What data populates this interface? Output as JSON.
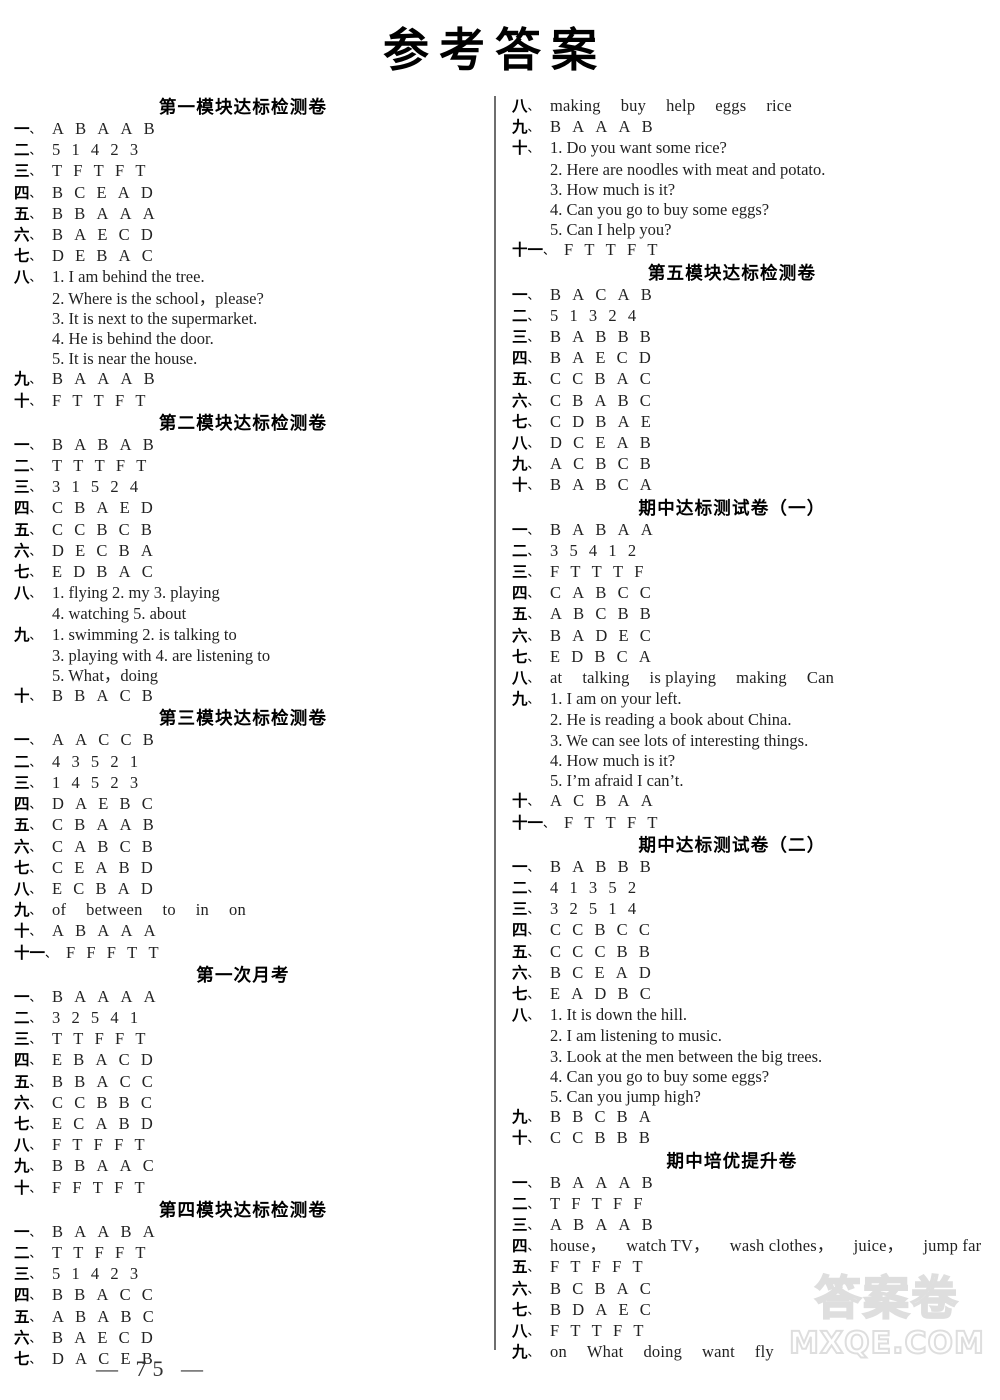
{
  "page": {
    "title": "参考答案",
    "page_number": "— 75 —",
    "watermark_cn": "答案卷",
    "watermark_url": "MXQE.COM"
  },
  "left_column": [
    {
      "heading": "第一模块达标检测卷",
      "rows": [
        {
          "num": "一",
          "type": "letters",
          "values": [
            "A",
            "B",
            "A",
            "A",
            "B"
          ]
        },
        {
          "num": "二",
          "type": "letters",
          "values": [
            "5",
            "1",
            "4",
            "2",
            "3"
          ]
        },
        {
          "num": "三",
          "type": "letters",
          "values": [
            "T",
            "F",
            "T",
            "F",
            "T"
          ]
        },
        {
          "num": "四",
          "type": "letters",
          "values": [
            "B",
            "C",
            "E",
            "A",
            "D"
          ]
        },
        {
          "num": "五",
          "type": "letters",
          "values": [
            "B",
            "B",
            "A",
            "A",
            "A"
          ]
        },
        {
          "num": "六",
          "type": "letters",
          "values": [
            "B",
            "A",
            "E",
            "C",
            "D"
          ]
        },
        {
          "num": "七",
          "type": "letters",
          "values": [
            "D",
            "E",
            "B",
            "A",
            "C"
          ]
        },
        {
          "num": "八",
          "type": "sentences",
          "sentences": [
            "1. I am behind the tree.",
            "2. Where is the school，please?",
            "3. It is next to the supermarket.",
            "4. He is behind the door.",
            "5. It is near the house."
          ]
        },
        {
          "num": "九",
          "type": "letters",
          "values": [
            "B",
            "A",
            "A",
            "A",
            "B"
          ]
        },
        {
          "num": "十",
          "type": "letters",
          "values": [
            "F",
            "T",
            "T",
            "F",
            "T"
          ]
        }
      ]
    },
    {
      "heading": "第二模块达标检测卷",
      "rows": [
        {
          "num": "一",
          "type": "letters",
          "values": [
            "B",
            "A",
            "B",
            "A",
            "B"
          ]
        },
        {
          "num": "二",
          "type": "letters",
          "values": [
            "T",
            "T",
            "T",
            "F",
            "T"
          ]
        },
        {
          "num": "三",
          "type": "letters",
          "values": [
            "3",
            "1",
            "5",
            "2",
            "4"
          ]
        },
        {
          "num": "四",
          "type": "letters",
          "values": [
            "C",
            "B",
            "A",
            "E",
            "D"
          ]
        },
        {
          "num": "五",
          "type": "letters",
          "values": [
            "C",
            "C",
            "B",
            "C",
            "B"
          ]
        },
        {
          "num": "六",
          "type": "letters",
          "values": [
            "D",
            "E",
            "C",
            "B",
            "A"
          ]
        },
        {
          "num": "七",
          "type": "letters",
          "values": [
            "E",
            "D",
            "B",
            "A",
            "C"
          ]
        },
        {
          "num": "八",
          "type": "sentences",
          "sentences": [
            "1. flying    2. my   3. playing",
            "4. watching     5. about"
          ]
        },
        {
          "num": "九",
          "type": "sentences",
          "sentences": [
            "1. swimming    2. is talking to",
            "3. playing with 4. are listening to",
            "5. What，doing"
          ]
        },
        {
          "num": "十",
          "type": "letters",
          "values": [
            "B",
            "B",
            "A",
            "C",
            "B"
          ]
        }
      ]
    },
    {
      "heading": "第三模块达标检测卷",
      "rows": [
        {
          "num": "一",
          "type": "letters",
          "values": [
            "A",
            "A",
            "C",
            "C",
            "B"
          ]
        },
        {
          "num": "二",
          "type": "letters",
          "values": [
            "4",
            "3",
            "5",
            "2",
            "1"
          ]
        },
        {
          "num": "三",
          "type": "letters",
          "values": [
            "1",
            "4",
            "5",
            "2",
            "3"
          ]
        },
        {
          "num": "四",
          "type": "letters",
          "values": [
            "D",
            "A",
            "E",
            "B",
            "C"
          ]
        },
        {
          "num": "五",
          "type": "letters",
          "values": [
            "C",
            "B",
            "A",
            "A",
            "B"
          ]
        },
        {
          "num": "六",
          "type": "letters",
          "values": [
            "C",
            "A",
            "B",
            "C",
            "B"
          ]
        },
        {
          "num": "七",
          "type": "letters",
          "values": [
            "C",
            "E",
            "A",
            "B",
            "D"
          ]
        },
        {
          "num": "八",
          "type": "letters",
          "values": [
            "E",
            "C",
            "B",
            "A",
            "D"
          ]
        },
        {
          "num": "九",
          "type": "words",
          "values": [
            "of",
            "between",
            "to",
            "in",
            "on"
          ]
        },
        {
          "num": "十",
          "type": "letters",
          "values": [
            "A",
            "B",
            "A",
            "A",
            "A"
          ]
        },
        {
          "num": "十一",
          "type": "letters",
          "wide": true,
          "values": [
            "F",
            "F",
            "F",
            "T",
            "T"
          ]
        }
      ]
    },
    {
      "heading": "第一次月考",
      "rows": [
        {
          "num": "一",
          "type": "letters",
          "values": [
            "B",
            "A",
            "A",
            "A",
            "A"
          ]
        },
        {
          "num": "二",
          "type": "letters",
          "values": [
            "3",
            "2",
            "5",
            "4",
            "1"
          ]
        },
        {
          "num": "三",
          "type": "letters",
          "values": [
            "T",
            "T",
            "F",
            "F",
            "T"
          ]
        },
        {
          "num": "四",
          "type": "letters",
          "values": [
            "E",
            "B",
            "A",
            "C",
            "D"
          ]
        },
        {
          "num": "五",
          "type": "letters",
          "values": [
            "B",
            "B",
            "A",
            "C",
            "C"
          ]
        },
        {
          "num": "六",
          "type": "letters",
          "values": [
            "C",
            "C",
            "B",
            "B",
            "C"
          ]
        },
        {
          "num": "七",
          "type": "letters",
          "values": [
            "E",
            "C",
            "A",
            "B",
            "D"
          ]
        },
        {
          "num": "八",
          "type": "letters",
          "values": [
            "F",
            "T",
            "F",
            "F",
            "T"
          ]
        },
        {
          "num": "九",
          "type": "letters",
          "values": [
            "B",
            "B",
            "A",
            "A",
            "C"
          ]
        },
        {
          "num": "十",
          "type": "letters",
          "values": [
            "F",
            "F",
            "T",
            "F",
            "T"
          ]
        }
      ]
    },
    {
      "heading": "第四模块达标检测卷",
      "rows": [
        {
          "num": "一",
          "type": "letters",
          "values": [
            "B",
            "A",
            "A",
            "B",
            "A"
          ]
        },
        {
          "num": "二",
          "type": "letters",
          "values": [
            "T",
            "T",
            "F",
            "F",
            "T"
          ]
        },
        {
          "num": "三",
          "type": "letters",
          "values": [
            "5",
            "1",
            "4",
            "2",
            "3"
          ]
        },
        {
          "num": "四",
          "type": "letters",
          "values": [
            "B",
            "B",
            "A",
            "C",
            "C"
          ]
        },
        {
          "num": "五",
          "type": "letters",
          "values": [
            "A",
            "B",
            "A",
            "B",
            "C"
          ]
        },
        {
          "num": "六",
          "type": "letters",
          "values": [
            "B",
            "A",
            "E",
            "C",
            "D"
          ]
        },
        {
          "num": "七",
          "type": "letters",
          "values": [
            "D",
            "A",
            "C",
            "E",
            "B"
          ]
        }
      ]
    }
  ],
  "right_column": [
    {
      "heading": "",
      "rows": [
        {
          "num": "八",
          "type": "words",
          "values": [
            "making",
            "buy",
            "help",
            "eggs",
            "rice"
          ]
        },
        {
          "num": "九",
          "type": "letters",
          "values": [
            "B",
            "A",
            "A",
            "A",
            "B"
          ]
        },
        {
          "num": "十",
          "type": "sentences",
          "sentences": [
            "1. Do you want some rice?",
            "2. Here are noodles with meat and potato.",
            "3. How much is it?",
            "4. Can you go to buy some eggs?",
            "5. Can I help you?"
          ]
        },
        {
          "num": "十一",
          "type": "letters",
          "wide": true,
          "values": [
            "F",
            "T",
            "T",
            "F",
            "T"
          ]
        }
      ]
    },
    {
      "heading": "第五模块达标检测卷",
      "rows": [
        {
          "num": "一",
          "type": "letters",
          "values": [
            "B",
            "A",
            "C",
            "A",
            "B"
          ]
        },
        {
          "num": "二",
          "type": "letters",
          "values": [
            "5",
            "1",
            "3",
            "2",
            "4"
          ]
        },
        {
          "num": "三",
          "type": "letters",
          "values": [
            "B",
            "A",
            "B",
            "B",
            "B"
          ]
        },
        {
          "num": "四",
          "type": "letters",
          "values": [
            "B",
            "A",
            "E",
            "C",
            "D"
          ]
        },
        {
          "num": "五",
          "type": "letters",
          "values": [
            "C",
            "C",
            "B",
            "A",
            "C"
          ]
        },
        {
          "num": "六",
          "type": "letters",
          "values": [
            "C",
            "B",
            "A",
            "B",
            "C"
          ]
        },
        {
          "num": "七",
          "type": "letters",
          "values": [
            "C",
            "D",
            "B",
            "A",
            "E"
          ]
        },
        {
          "num": "八",
          "type": "letters",
          "values": [
            "D",
            "C",
            "E",
            "A",
            "B"
          ]
        },
        {
          "num": "九",
          "type": "letters",
          "values": [
            "A",
            "C",
            "B",
            "C",
            "B"
          ]
        },
        {
          "num": "十",
          "type": "letters",
          "values": [
            "B",
            "A",
            "B",
            "C",
            "A"
          ]
        }
      ]
    },
    {
      "heading": "期中达标测试卷（一）",
      "rows": [
        {
          "num": "一",
          "type": "letters",
          "values": [
            "B",
            "A",
            "B",
            "A",
            "A"
          ]
        },
        {
          "num": "二",
          "type": "letters",
          "values": [
            "3",
            "5",
            "4",
            "1",
            "2"
          ]
        },
        {
          "num": "三",
          "type": "letters",
          "values": [
            "F",
            "T",
            "T",
            "T",
            "F"
          ]
        },
        {
          "num": "四",
          "type": "letters",
          "values": [
            "C",
            "A",
            "B",
            "C",
            "C"
          ]
        },
        {
          "num": "五",
          "type": "letters",
          "values": [
            "A",
            "B",
            "C",
            "B",
            "B"
          ]
        },
        {
          "num": "六",
          "type": "letters",
          "values": [
            "B",
            "A",
            "D",
            "E",
            "C"
          ]
        },
        {
          "num": "七",
          "type": "letters",
          "values": [
            "E",
            "D",
            "B",
            "C",
            "A"
          ]
        },
        {
          "num": "八",
          "type": "words",
          "values": [
            "at",
            "talking",
            "is playing",
            "making",
            "Can"
          ]
        },
        {
          "num": "九",
          "type": "sentences",
          "sentences": [
            "1. I am on your left.",
            "2. He is reading a book about China.",
            "3. We can see lots of interesting things.",
            "4. How much is it?",
            "5. I’m afraid I can’t."
          ]
        },
        {
          "num": "十",
          "type": "letters",
          "values": [
            "A",
            "C",
            "B",
            "A",
            "A"
          ]
        },
        {
          "num": "十一",
          "type": "letters",
          "wide": true,
          "values": [
            "F",
            "T",
            "T",
            "F",
            "T"
          ]
        }
      ]
    },
    {
      "heading": "期中达标测试卷（二）",
      "rows": [
        {
          "num": "一",
          "type": "letters",
          "values": [
            "B",
            "A",
            "B",
            "B",
            "B"
          ]
        },
        {
          "num": "二",
          "type": "letters",
          "values": [
            "4",
            "1",
            "3",
            "5",
            "2"
          ]
        },
        {
          "num": "三",
          "type": "letters",
          "values": [
            "3",
            "2",
            "5",
            "1",
            "4"
          ]
        },
        {
          "num": "四",
          "type": "letters",
          "values": [
            "C",
            "C",
            "B",
            "C",
            "C"
          ]
        },
        {
          "num": "五",
          "type": "letters",
          "values": [
            "C",
            "C",
            "C",
            "B",
            "B"
          ]
        },
        {
          "num": "六",
          "type": "letters",
          "values": [
            "B",
            "C",
            "E",
            "A",
            "D"
          ]
        },
        {
          "num": "七",
          "type": "letters",
          "values": [
            "E",
            "A",
            "D",
            "B",
            "C"
          ]
        },
        {
          "num": "八",
          "type": "sentences",
          "sentences": [
            "1. It is down the hill.",
            "2. I am listening to music.",
            "3. Look at the men between the big trees.",
            "4. Can you go to buy some eggs?",
            "5. Can you jump high?"
          ]
        },
        {
          "num": "九",
          "type": "letters",
          "values": [
            "B",
            "B",
            "C",
            "B",
            "A"
          ]
        },
        {
          "num": "十",
          "type": "letters",
          "values": [
            "C",
            "C",
            "B",
            "B",
            "B"
          ]
        }
      ]
    },
    {
      "heading": "期中培优提升卷",
      "rows": [
        {
          "num": "一",
          "type": "letters",
          "values": [
            "B",
            "A",
            "A",
            "A",
            "B"
          ]
        },
        {
          "num": "二",
          "type": "letters",
          "values": [
            "T",
            "F",
            "T",
            "F",
            "F"
          ]
        },
        {
          "num": "三",
          "type": "letters",
          "values": [
            "A",
            "B",
            "A",
            "A",
            "B"
          ]
        },
        {
          "num": "四",
          "type": "words",
          "values": [
            "house，",
            "watch TV，",
            "wash clothes，",
            "juice，",
            "jump far"
          ]
        },
        {
          "num": "五",
          "type": "letters",
          "values": [
            "F",
            "T",
            "F",
            "F",
            "T"
          ]
        },
        {
          "num": "六",
          "type": "letters",
          "values": [
            "B",
            "C",
            "B",
            "A",
            "C"
          ]
        },
        {
          "num": "七",
          "type": "letters",
          "values": [
            "B",
            "D",
            "A",
            "E",
            "C"
          ]
        },
        {
          "num": "八",
          "type": "letters",
          "values": [
            "F",
            "T",
            "T",
            "F",
            "T"
          ]
        },
        {
          "num": "九",
          "type": "words",
          "values": [
            "on",
            "What",
            "doing",
            "want",
            "fly"
          ]
        }
      ]
    }
  ]
}
